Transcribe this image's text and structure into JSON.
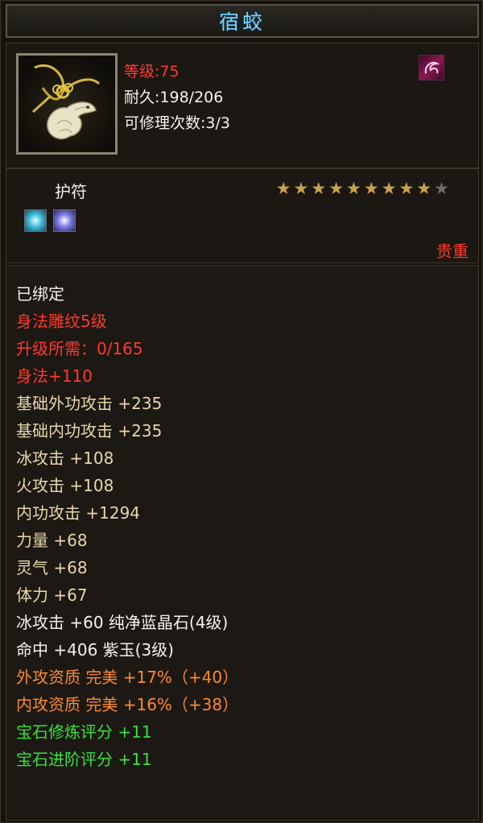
{
  "item": {
    "name": "宿蛟",
    "level_line": "等级:75",
    "durability_line": "耐久:198/206",
    "repair_line": "可修理次数:3/3",
    "type": "护符",
    "rarity": "贵重",
    "stars_filled": 9,
    "stars_total": 10
  },
  "attributes": [
    {
      "text": "已绑定",
      "color": "white"
    },
    {
      "text": "身法雕纹5级",
      "color": "red"
    },
    {
      "text": "升级所需：0/165",
      "color": "red"
    },
    {
      "text": "身法+110",
      "color": "red"
    },
    {
      "text": "基础外功攻击 +235",
      "color": "cream"
    },
    {
      "text": "基础内功攻击 +235",
      "color": "cream"
    },
    {
      "text": "冰攻击 +108",
      "color": "cream"
    },
    {
      "text": "火攻击 +108",
      "color": "cream"
    },
    {
      "text": "内功攻击 +1294",
      "color": "cream"
    },
    {
      "text": "力量 +68",
      "color": "cream"
    },
    {
      "text": "灵气 +68",
      "color": "cream"
    },
    {
      "text": "体力 +67",
      "color": "cream"
    },
    {
      "text": "冰攻击 +60 纯净蓝晶石(4级)",
      "color": "white"
    },
    {
      "text": "命中 +406 紫玉(3级)",
      "color": "white"
    },
    {
      "text": "外攻资质   完美 +17%（+40）",
      "color": "orange"
    },
    {
      "text": "内攻资质   完美 +16%（+38）",
      "color": "orange"
    },
    {
      "text": "宝石修炼评分 +11",
      "color": "green"
    },
    {
      "text": "宝石进阶评分 +11",
      "color": "green"
    }
  ],
  "colors": {
    "red": "#ff3a2e",
    "white": "#f2f2f2",
    "cream": "#e8d7a9",
    "orange": "#ff8a2a",
    "green": "#37e23a",
    "title": "#78d8ff",
    "star": "#c9a34a"
  },
  "icons": {
    "item": "jade-dragon-amulet-icon",
    "corner": "magenta-swirl-icon",
    "gem1": "blue-crystal-gem-icon",
    "gem2": "purple-jade-gem-icon"
  }
}
